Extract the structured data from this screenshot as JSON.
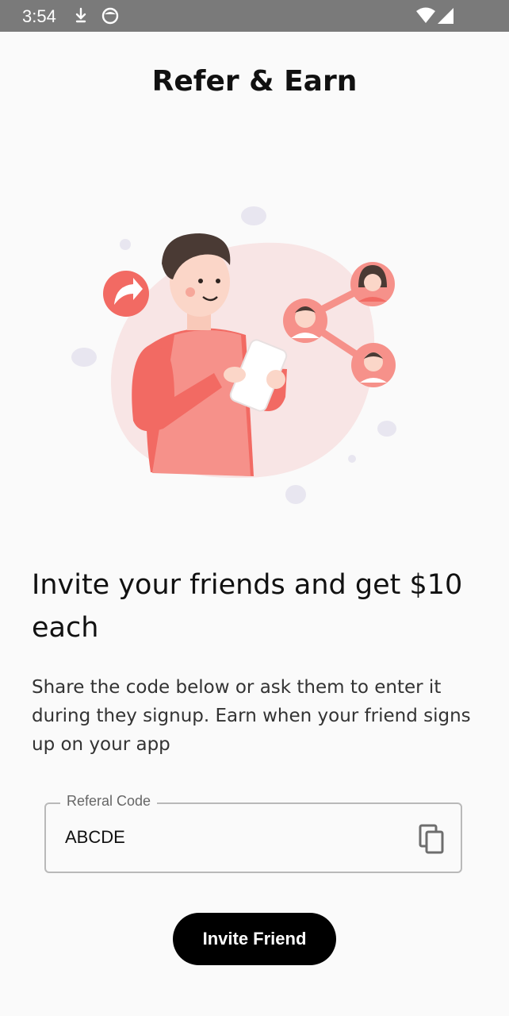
{
  "status_bar": {
    "time": "3:54",
    "icons": [
      "download-icon",
      "face-icon",
      "wifi-icon",
      "cell-signal-icon"
    ]
  },
  "page": {
    "title": "Refer & Earn",
    "headline": "Invite your friends and get $10 each",
    "description": "Share the code below or ask them to enter it during they signup. Earn when your friend signs up on your app"
  },
  "referral": {
    "label": "Referal Code",
    "code": "ABCDE",
    "copy_icon": "copy-icon"
  },
  "actions": {
    "invite_label": "Invite Friend"
  },
  "colors": {
    "accent": "#f26a63",
    "button": "#000000",
    "background": "#fafafa"
  }
}
